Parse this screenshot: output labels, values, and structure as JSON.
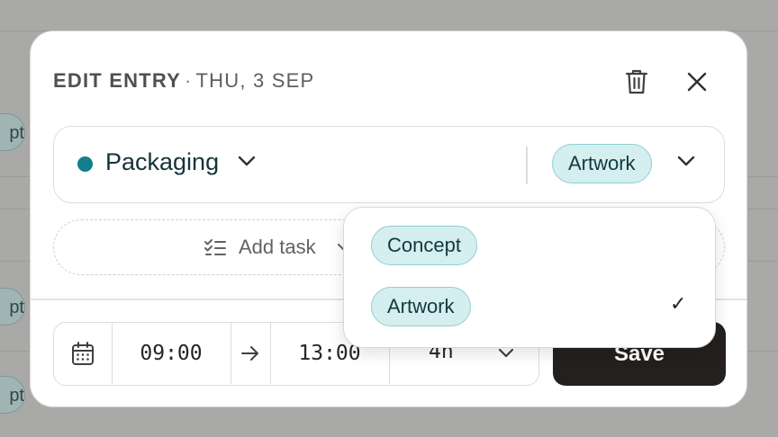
{
  "modal": {
    "title_edit": "EDIT ENTRY",
    "title_sep": "·",
    "title_date": "THU, 3 SEP"
  },
  "project": {
    "name": "Packaging",
    "color": "#127f8a",
    "tag": "Artwork"
  },
  "add_task": {
    "label": "Add task"
  },
  "time": {
    "start": "09:00",
    "end": "13:00",
    "duration": "4h"
  },
  "save": {
    "label": "Save"
  },
  "tag_dropdown": {
    "options": [
      {
        "label": "Concept",
        "selected": false
      },
      {
        "label": "Artwork",
        "selected": true,
        "check": "✓"
      }
    ]
  },
  "background": {
    "pill_fragments": [
      "pt",
      "pt",
      "pt"
    ]
  },
  "colors": {
    "accent_teal": "#127f8a",
    "tag_bg": "#d5eeef",
    "tag_border": "#8ed0d4",
    "save_bg": "#24201d"
  }
}
